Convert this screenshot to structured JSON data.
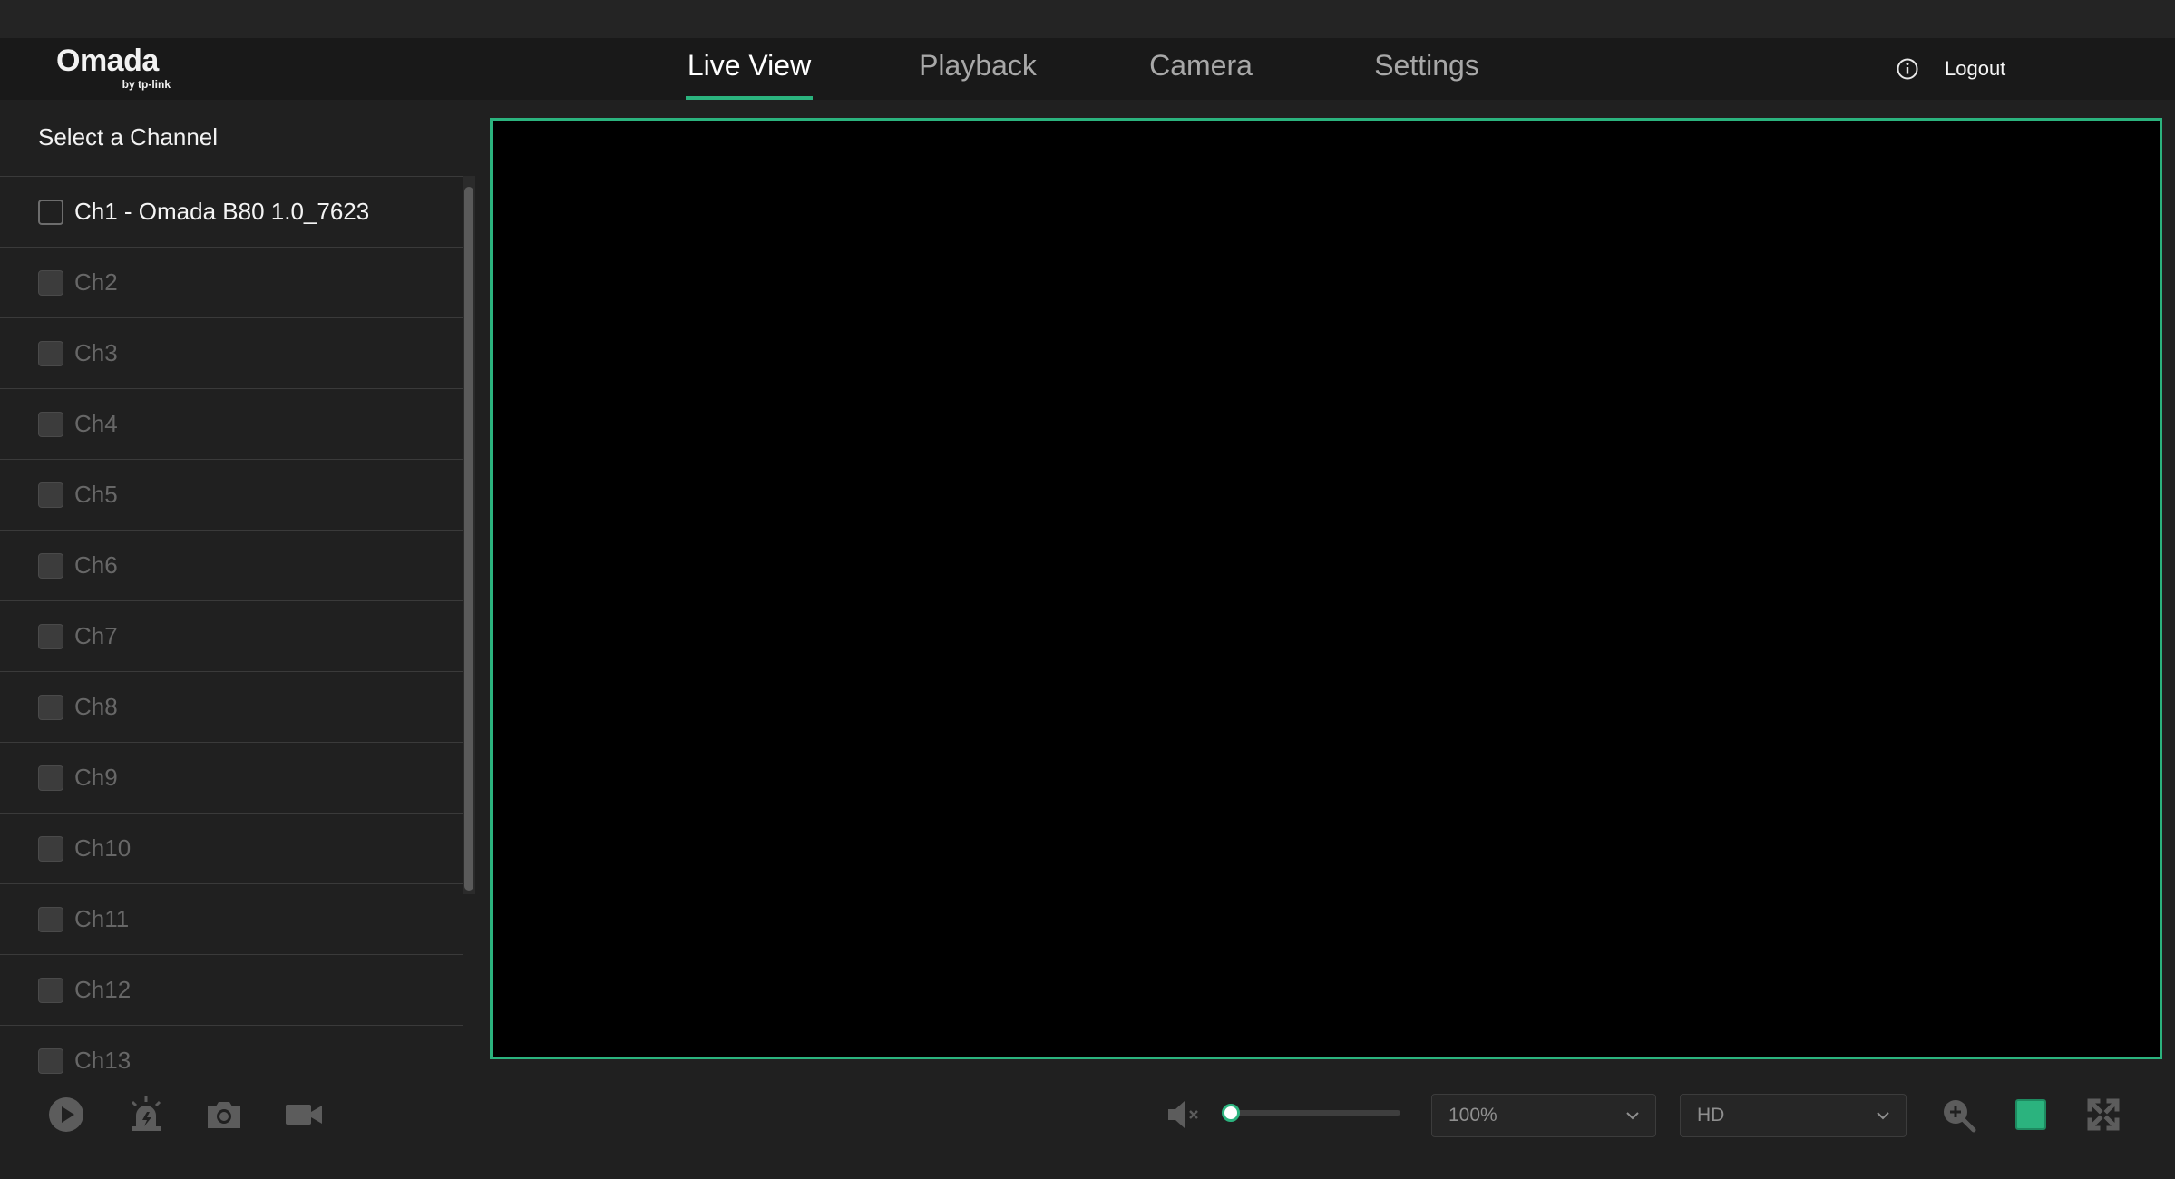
{
  "header": {
    "brand": "Omada",
    "brand_sub": "by tp-link",
    "tabs": [
      {
        "label": "Live View",
        "active": true
      },
      {
        "label": "Playback",
        "active": false
      },
      {
        "label": "Camera",
        "active": false
      },
      {
        "label": "Settings",
        "active": false
      }
    ],
    "info_icon": "info-circle-icon",
    "logout_label": "Logout"
  },
  "sidebar": {
    "title": "Select a Channel",
    "channels": [
      {
        "label": "Ch1 - Omada B80 1.0_7623",
        "online": true,
        "checked": false
      },
      {
        "label": "Ch2",
        "online": false
      },
      {
        "label": "Ch3",
        "online": false
      },
      {
        "label": "Ch4",
        "online": false
      },
      {
        "label": "Ch5",
        "online": false
      },
      {
        "label": "Ch6",
        "online": false
      },
      {
        "label": "Ch7",
        "online": false
      },
      {
        "label": "Ch8",
        "online": false
      },
      {
        "label": "Ch9",
        "online": false
      },
      {
        "label": "Ch10",
        "online": false
      },
      {
        "label": "Ch11",
        "online": false
      },
      {
        "label": "Ch12",
        "online": false
      },
      {
        "label": "Ch13",
        "online": false
      }
    ]
  },
  "toolbar": {
    "left_icons": [
      "play-icon",
      "alarm-icon",
      "snapshot-icon",
      "record-icon"
    ],
    "volume_icon": "mute-icon",
    "volume_level": 0,
    "zoom_select": "100%",
    "quality_select": "HD",
    "right_icons": [
      "zoom-in-icon",
      "single-view-icon",
      "fullscreen-icon"
    ]
  },
  "colors": {
    "accent": "#2bb37e",
    "background": "#202020",
    "header": "#191919"
  }
}
